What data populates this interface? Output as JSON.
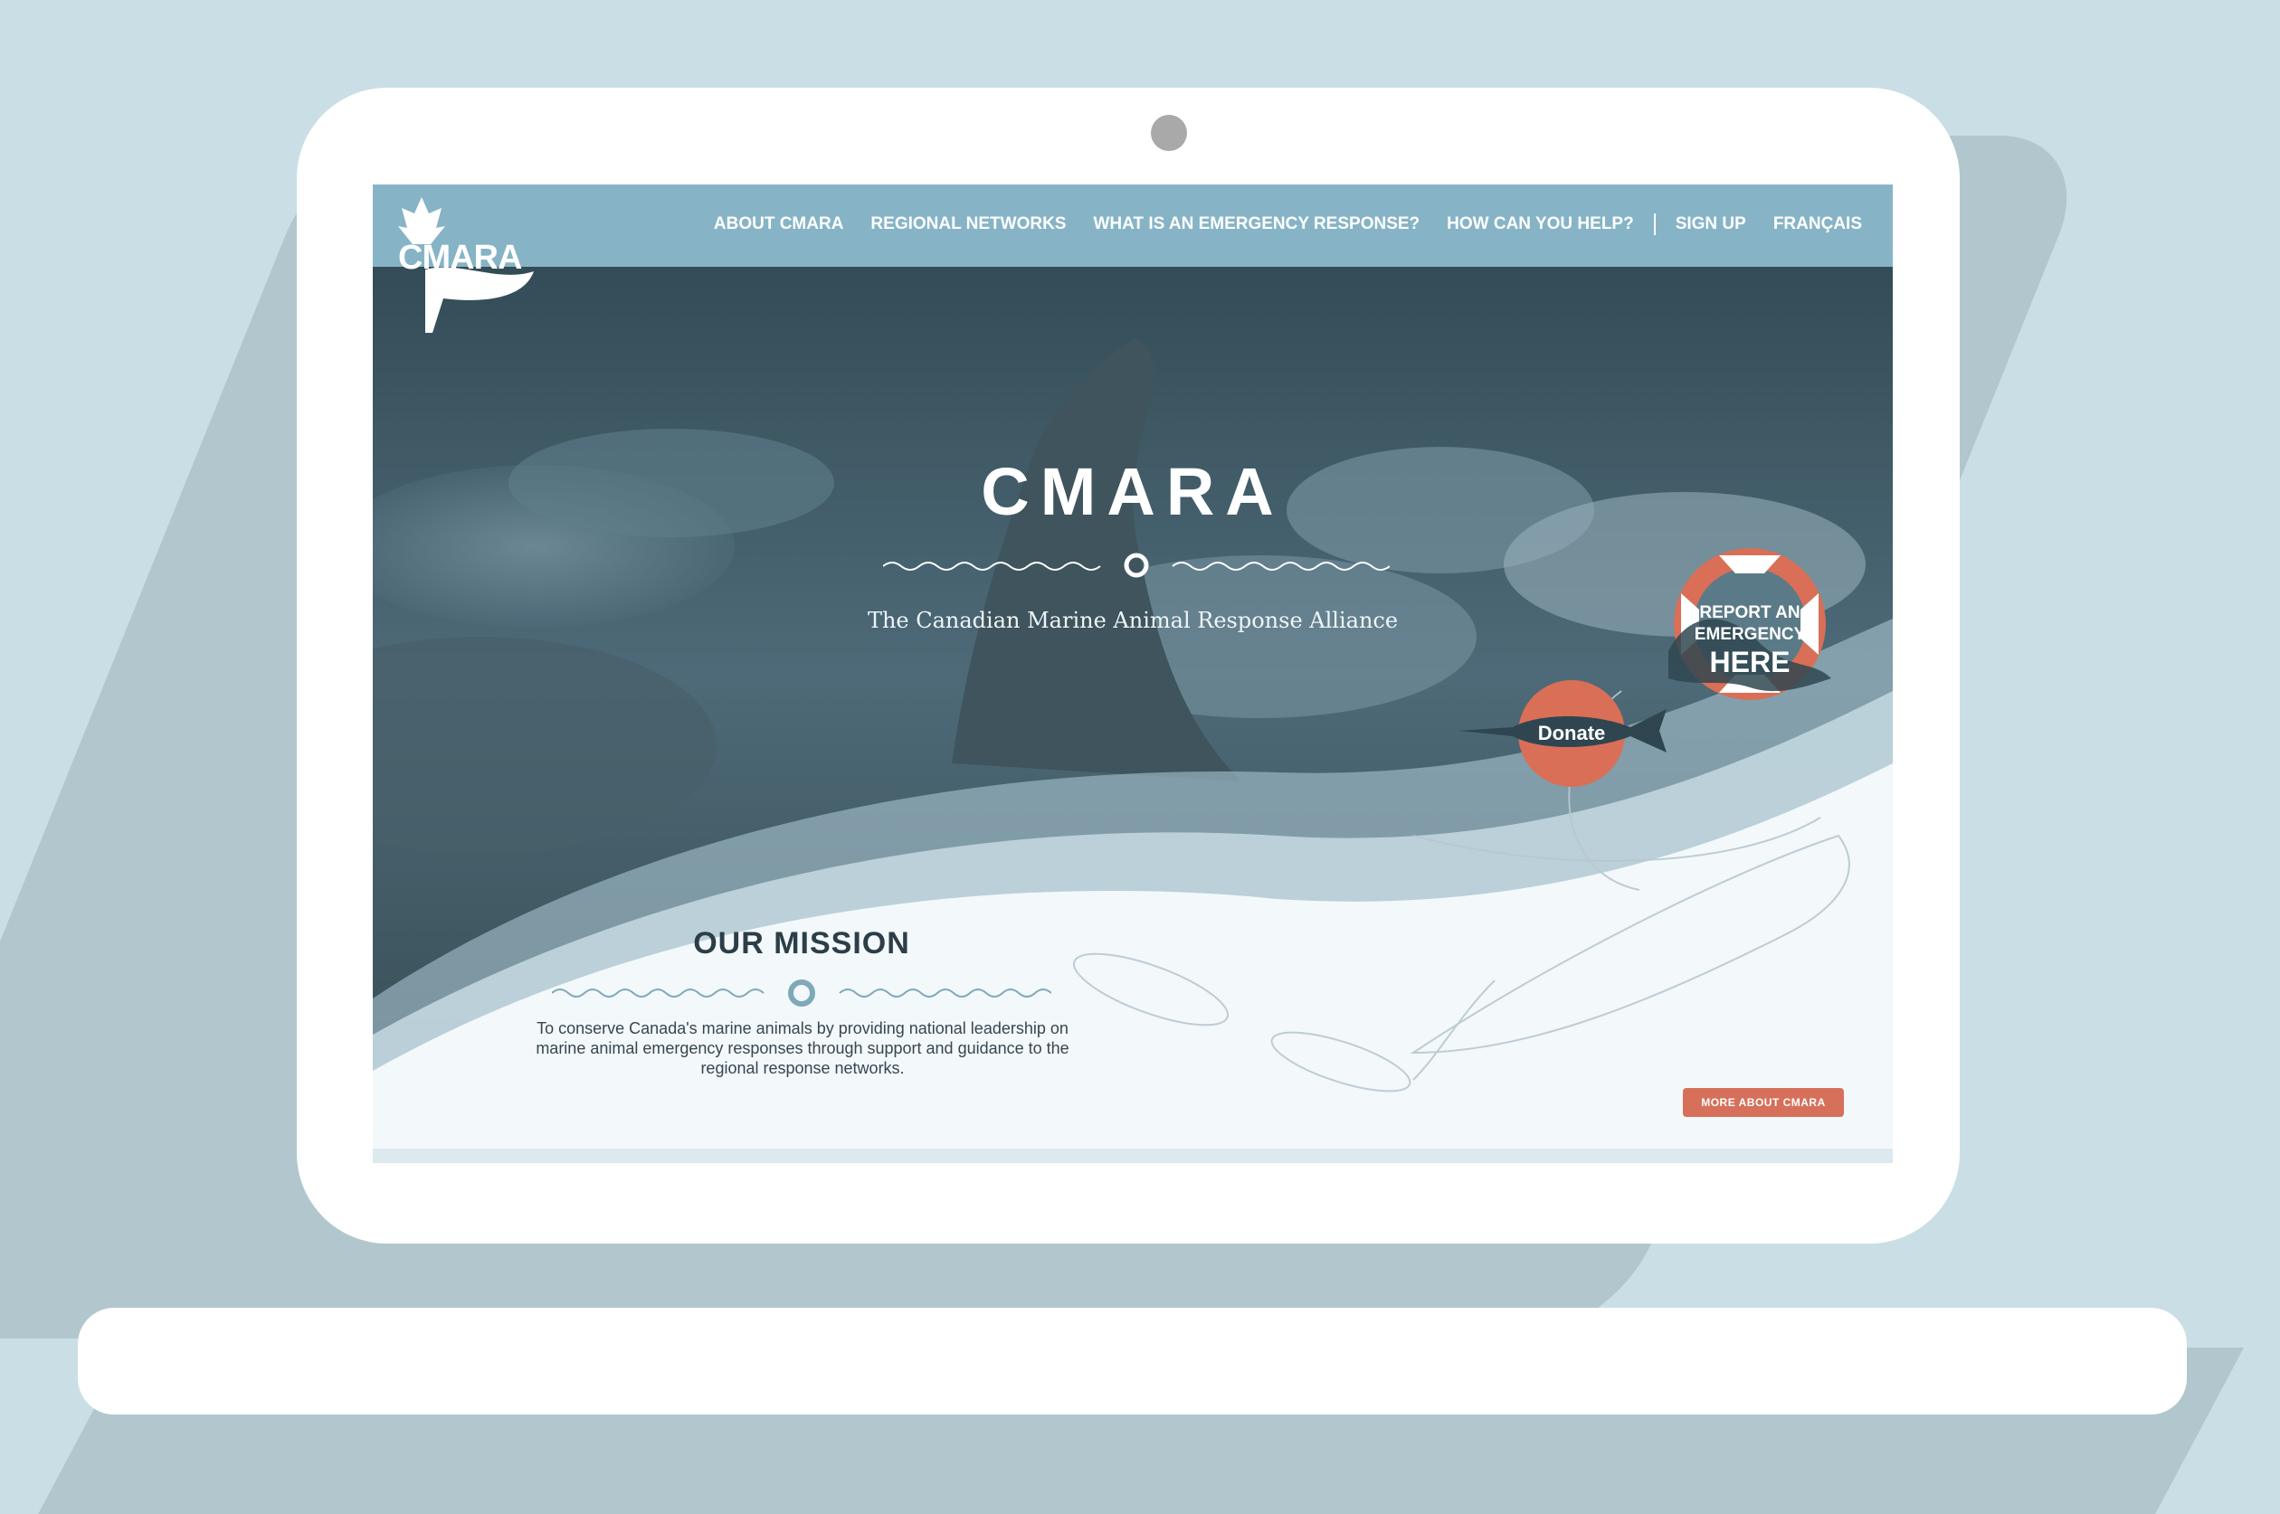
{
  "nav": {
    "logo_text": "CMARA",
    "items": [
      {
        "label": "ABOUT CMARA"
      },
      {
        "label": "REGIONAL NETWORKS"
      },
      {
        "label": "WHAT IS AN EMERGENCY RESPONSE?"
      },
      {
        "label": "HOW CAN YOU HELP?"
      }
    ],
    "signup_label": "SIGN UP",
    "language_label": "FRANÇAIS"
  },
  "hero": {
    "title": "CMARA",
    "subtitle": "The Canadian Marine Animal Response Alliance"
  },
  "report": {
    "line1": "REPORT AN",
    "line2": "EMERGENCY",
    "line3": "HERE"
  },
  "donate": {
    "label": "Donate"
  },
  "mission": {
    "title": "OUR MISSION",
    "text": "To conserve Canada's marine animals by providing national leadership on marine animal emergency responses through support and guidance to the regional response networks.",
    "more_label": "MORE ABOUT CMARA"
  },
  "colors": {
    "nav_bg": "#86b4c6",
    "accent": "#d96f57",
    "dark_text": "#2c3e47",
    "page_bg": "#c9dfe5"
  },
  "icons": {
    "logo": "maple-leaf-flag-icon",
    "lifebuoy": "lifebuoy-icon",
    "whale": "whale-icon",
    "swordfish": "swordfish-icon"
  }
}
